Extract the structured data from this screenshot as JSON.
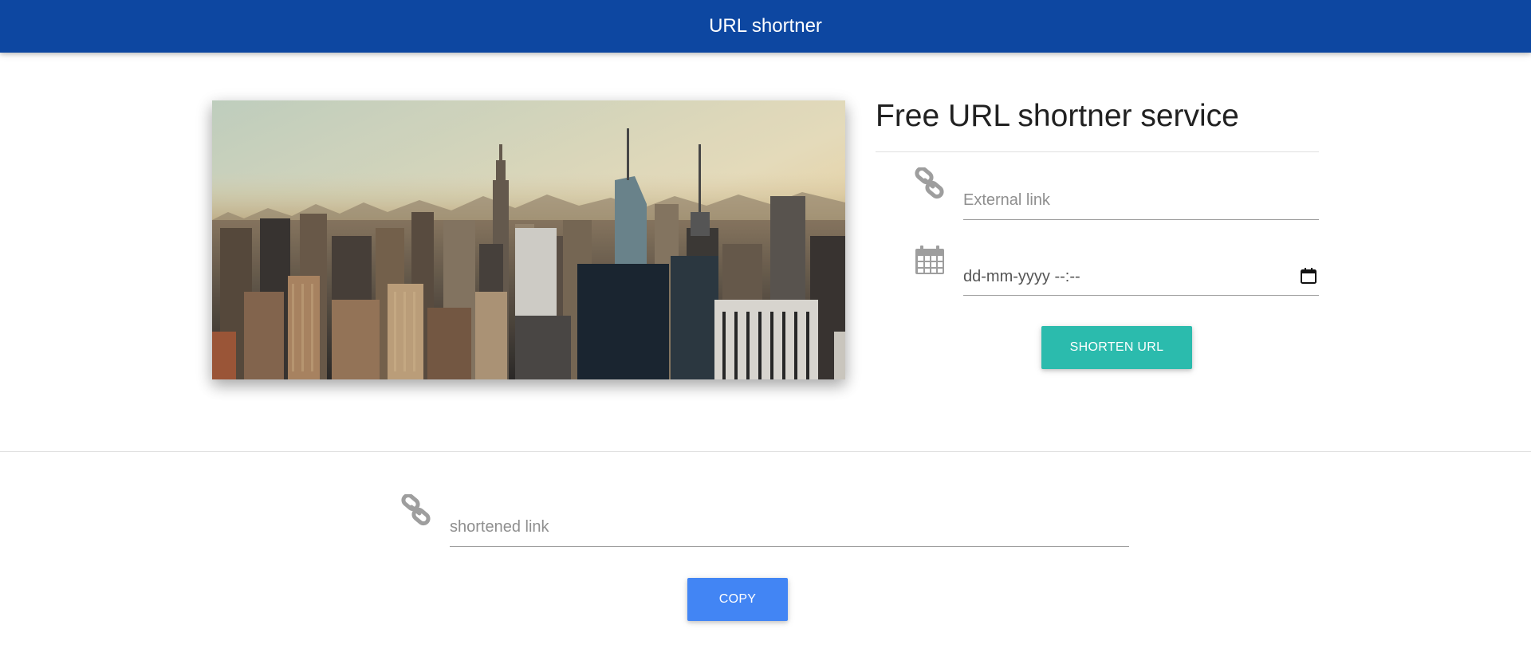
{
  "navbar": {
    "brand": "URL shortner"
  },
  "hero": {
    "image": "city-skyline-photo"
  },
  "form": {
    "title": "Free URL shortner service",
    "external_link": {
      "placeholder": "External link",
      "icon": "link-icon"
    },
    "expiry": {
      "placeholder": "dd-mm-yyyy --:--",
      "icon": "calendar-icon"
    },
    "shorten_label": "SHORTEN URL"
  },
  "result": {
    "shortened_link": {
      "placeholder": "shortened link",
      "icon": "link-icon"
    },
    "copy_label": "COPY"
  },
  "colors": {
    "navbar": "#0d47a1",
    "shorten_button": "#2bbbad",
    "copy_button": "#4285f4"
  }
}
